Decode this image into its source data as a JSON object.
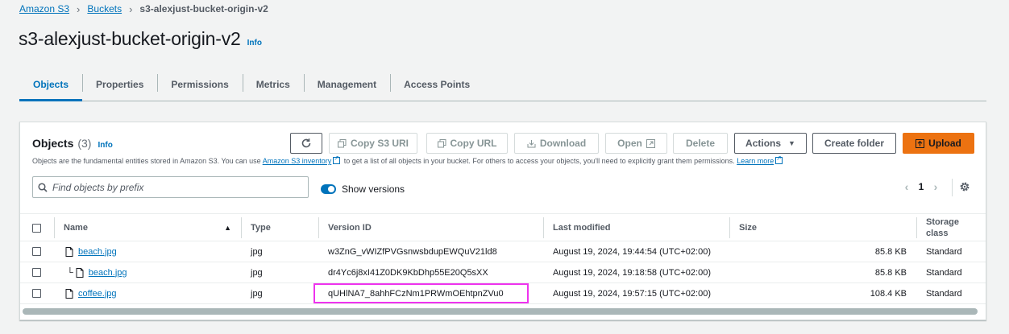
{
  "breadcrumb": {
    "root": "Amazon S3",
    "buckets": "Buckets",
    "current": "s3-alexjust-bucket-origin-v2"
  },
  "page": {
    "title": "s3-alexjust-bucket-origin-v2",
    "info": "Info"
  },
  "tabs": [
    {
      "label": "Objects",
      "active": true
    },
    {
      "label": "Properties"
    },
    {
      "label": "Permissions"
    },
    {
      "label": "Metrics"
    },
    {
      "label": "Management"
    },
    {
      "label": "Access Points"
    }
  ],
  "objects_panel": {
    "heading": "Objects",
    "count": "(3)",
    "info": "Info",
    "description_part1": "Objects are the fundamental entities stored in Amazon S3. You can use ",
    "inventory_link": "Amazon S3 inventory",
    "description_part2": " to get a list of all objects in your bucket. For others to access your objects, you'll need to explicitly grant them permissions. ",
    "learn_more": "Learn more",
    "buttons": {
      "refresh_icon": "refresh-icon",
      "copy_s3_uri": "Copy S3 URI",
      "copy_url": "Copy URL",
      "download": "Download",
      "open": "Open",
      "delete": "Delete",
      "actions": "Actions",
      "create_folder": "Create folder",
      "upload": "Upload"
    },
    "search": {
      "placeholder": "Find objects by prefix"
    },
    "show_versions": {
      "label": "Show versions",
      "on": true
    },
    "pagination": {
      "page": "1"
    }
  },
  "table": {
    "columns": {
      "name": "Name",
      "type": "Type",
      "version_id": "Version ID",
      "last_modified": "Last modified",
      "size": "Size",
      "storage_class_1": "Storage",
      "storage_class_2": "class"
    },
    "rows": [
      {
        "name": "beach.jpg",
        "type": "jpg",
        "version_id": "w3ZnG_vWIZfPVGsnwsbdupEWQuV21ld8",
        "last_modified": "August 19, 2024, 19:44:54 (UTC+02:00)",
        "size": "85.8 KB",
        "storage_class": "Standard"
      },
      {
        "name": "beach.jpg",
        "type": "jpg",
        "version_id": "dr4Yc6j8xI41Z0DK9KbDhp55E20Q5sXX",
        "last_modified": "August 19, 2024, 19:18:58 (UTC+02:00)",
        "size": "85.8 KB",
        "storage_class": "Standard"
      },
      {
        "name": "coffee.jpg",
        "type": "jpg",
        "version_id": "qUHlNA7_8ahhFCzNm1PRWmOEhtpnZVu0",
        "last_modified": "August 19, 2024, 19:57:15 (UTC+02:00)",
        "size": "108.4 KB",
        "storage_class": "Standard"
      }
    ]
  },
  "colors": {
    "link": "#0073bb",
    "upload": "#ec7211",
    "highlight": "#ee33ee"
  }
}
